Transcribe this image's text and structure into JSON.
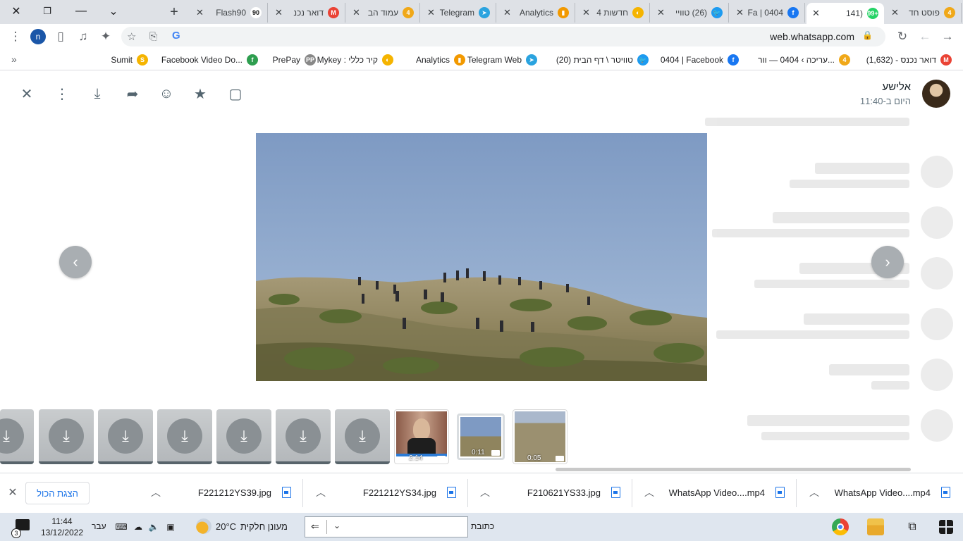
{
  "browser": {
    "window_controls": {
      "close": "✕",
      "restore": "❐",
      "minimize": "—",
      "tab_search": "⌄"
    },
    "new_tab": "+",
    "tabs": [
      {
        "title": "Flash90",
        "favicon_text": "90",
        "favicon_color": "#ffffff",
        "active": false
      },
      {
        "title": "דואר נכנ",
        "favicon_text": "M",
        "favicon_color": "#ea4335",
        "active": false
      },
      {
        "title": "עמוד הב",
        "favicon_text": "4",
        "favicon_color": "#f0a818",
        "active": false
      },
      {
        "title": "Telegram",
        "favicon_text": "➤",
        "favicon_color": "#2aa3df",
        "active": false
      },
      {
        "title": "Analytics",
        "favicon_text": "▮",
        "favicon_color": "#f29900",
        "active": false
      },
      {
        "title": "חדשות 4",
        "favicon_text": "◐",
        "favicon_color": "#f5b400",
        "active": false
      },
      {
        "title": "(26) טוויי",
        "favicon_text": "🐦",
        "favicon_color": "#1d9bf0",
        "active": false
      },
      {
        "title": "0404 | Fa",
        "favicon_text": "f",
        "favicon_color": "#1877f2",
        "active": false
      },
      {
        "title": "(141",
        "favicon_text": "99+",
        "favicon_color": "#25d366",
        "active": true
      },
      {
        "title": "פוסט חד",
        "favicon_text": "4",
        "favicon_color": "#f0a818",
        "active": false
      }
    ],
    "url": "web.whatsapp.com",
    "profile_initial": "n",
    "bookmarks": [
      {
        "label": "דואר נכנס - (1,632)",
        "favicon_text": "M",
        "favicon_color": "#ea4335"
      },
      {
        "label": "עריכה › 0404 — וור...",
        "favicon_text": "4",
        "favicon_color": "#f0a818"
      },
      {
        "label": "0404 | Facebook",
        "favicon_text": "f",
        "favicon_color": "#1877f2"
      },
      {
        "label": "(20) טוויטר \\ דף הבית",
        "favicon_text": "🐦",
        "favicon_color": "#1d9bf0"
      },
      {
        "label": "Telegram Web",
        "favicon_text": "➤",
        "favicon_color": "#2aa3df"
      },
      {
        "label": "Analytics",
        "favicon_text": "▮",
        "favicon_color": "#f29900"
      },
      {
        "label": "Mykey : קיר כללי",
        "favicon_text": "◐",
        "favicon_color": "#f5b400"
      },
      {
        "label": "PrePay",
        "favicon_text": "PP",
        "favicon_color": "#888888"
      },
      {
        "label": "Facebook Video Do...",
        "favicon_text": "f",
        "favicon_color": "#2e9e4f"
      },
      {
        "label": "Sumit",
        "favicon_text": "S",
        "favicon_color": "#f5b400"
      }
    ],
    "bookmarks_more": "»"
  },
  "viewer": {
    "sender_name": "אלישע",
    "sender_time": "היום ב-11:40",
    "actions": [
      "close-icon",
      "menu-icon",
      "download-icon",
      "forward-icon",
      "emoji-icon",
      "star-icon",
      "reply-icon"
    ],
    "thumbnails": [
      {
        "type": "download",
        "duration": ""
      },
      {
        "type": "download",
        "duration": ""
      },
      {
        "type": "download",
        "duration": ""
      },
      {
        "type": "download",
        "duration": ""
      },
      {
        "type": "download",
        "duration": ""
      },
      {
        "type": "download",
        "duration": ""
      },
      {
        "type": "download",
        "duration": ""
      },
      {
        "type": "video",
        "duration": "2:14"
      },
      {
        "type": "video",
        "duration": "0:11"
      },
      {
        "type": "video",
        "duration": "0:05"
      }
    ]
  },
  "downloads": {
    "show_all": "הצגת הכול",
    "items": [
      {
        "name": "WhatsApp Video....mp4"
      },
      {
        "name": "WhatsApp Video....mp4"
      },
      {
        "name": "F210621YS33.jpg"
      },
      {
        "name": "F221212YS34.jpg"
      },
      {
        "name": "F221212YS39.jpg"
      }
    ]
  },
  "taskbar": {
    "time": "11:44",
    "date": "13/12/2022",
    "notifications": "3",
    "language": "עבר",
    "weather_temp": "20°C",
    "weather_desc": "מעונן חלקית",
    "address_label": "כתובת"
  }
}
